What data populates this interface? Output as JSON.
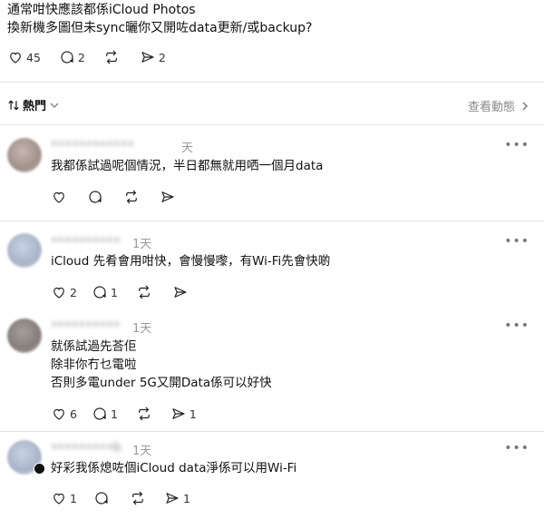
{
  "post": {
    "line1": "通常咁快應該都係iCloud Photos",
    "line2": "換新機多圖但未sync曬你又開咗data更新/或backup?",
    "like_count": "45",
    "reply_count": "2",
    "share_count": "2"
  },
  "sort": {
    "label": "熱門"
  },
  "activity_link": "查看動態",
  "comments": [
    {
      "username": "••••••••••••",
      "time": "天",
      "lines": [
        "我都係試過呢個情況，半日都無就用哂一個月data"
      ],
      "likes": "",
      "replies": "",
      "shares": ""
    },
    {
      "username": "••••••••••",
      "time": "1天",
      "lines": [
        "iCloud 先肴會用咁快，會慢慢嚟，有Wi-Fi先會快啲"
      ],
      "likes": "2",
      "replies": "1",
      "shares": ""
    },
    {
      "username": "••••••••••",
      "time": "1天",
      "lines": [
        "就係試過先荅佢",
        "除非你冇乜電啦",
        "否則多電under 5G又開Data係可以好快"
      ],
      "likes": "6",
      "replies": "1",
      "shares": "1"
    },
    {
      "username": "•••••••••b",
      "time": "1天",
      "lines": [
        "好彩我係熄咗個iCloud data淨係可以用Wi-Fi"
      ],
      "likes": "1",
      "replies": "",
      "shares": "1"
    }
  ],
  "more_glyph": "•••",
  "icons": [
    "heart-icon",
    "comment-icon",
    "repost-icon",
    "send-icon",
    "sort-arrows-icon",
    "chevron-down-icon",
    "chevron-right-icon",
    "more-icon"
  ]
}
